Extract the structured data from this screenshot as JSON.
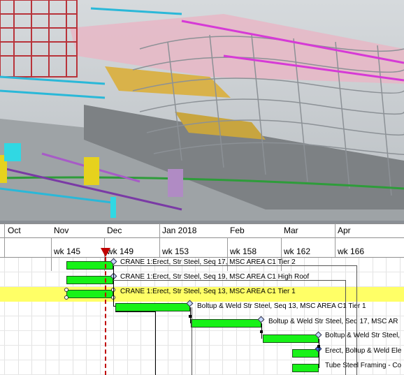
{
  "schedule": {
    "months": [
      "Oct",
      "Nov",
      "Dec",
      "Jan 2018",
      "Feb",
      "Mar",
      "Apr"
    ],
    "weeks": [
      "wk 145",
      "wk 149",
      "wk 153",
      "wk 158",
      "wk 162",
      "wk 166"
    ],
    "tasks": [
      {
        "label": "CRANE 1:Erect, Str Steel, Seq 17,  MSC AREA C1 Tier 2",
        "highlighted": false
      },
      {
        "label": "CRANE 1:Erect, Str Steel, Seq 19,  MSC AREA C1 High Roof",
        "highlighted": false
      },
      {
        "label": "CRANE 1:Erect, Str Steel, Seq 13,  MSC AREA C1 Tier 1",
        "highlighted": true
      },
      {
        "label": "Boltup & Weld Str Steel, Seq 13, MSC AREA C1 Tier 1",
        "highlighted": false
      },
      {
        "label": "Boltup & Weld Str Steel, Seq 17, MSC AR",
        "highlighted": false
      },
      {
        "label": "Boltup & Weld Str Steel,",
        "highlighted": false
      },
      {
        "label": "Erect, Boltup & Weld Ele",
        "highlighted": false
      },
      {
        "label": "Tube Steel Framing - Co",
        "highlighted": false
      }
    ]
  },
  "colors": {
    "bar_fill": "#17f217",
    "highlight_row": "#ffff66",
    "current_date_marker": "#c00000"
  }
}
